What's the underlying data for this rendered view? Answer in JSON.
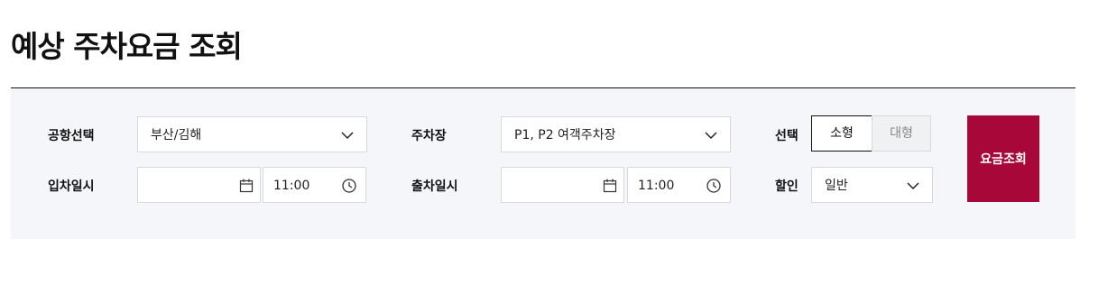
{
  "page": {
    "title": "예상 주차요금 조회"
  },
  "form": {
    "airport": {
      "label": "공항선택",
      "value": "부산/김해"
    },
    "parking_lot": {
      "label": "주차장",
      "value": "P1, P2 여객주차장"
    },
    "car_type": {
      "label": "선택",
      "options": [
        "소형",
        "대형"
      ],
      "selected": "소형"
    },
    "entry": {
      "label": "입차일시",
      "date": "",
      "time": "11:00"
    },
    "exit": {
      "label": "출차일시",
      "date": "",
      "time": "11:00"
    },
    "discount": {
      "label": "할인",
      "value": "일반"
    },
    "submit_label": "요금조회"
  },
  "colors": {
    "accent": "#a8073a",
    "panel_bg": "#f4f6f9"
  },
  "icons": {
    "dropdown": "chevron-down-icon",
    "date": "calendar-icon",
    "time": "clock-icon"
  }
}
